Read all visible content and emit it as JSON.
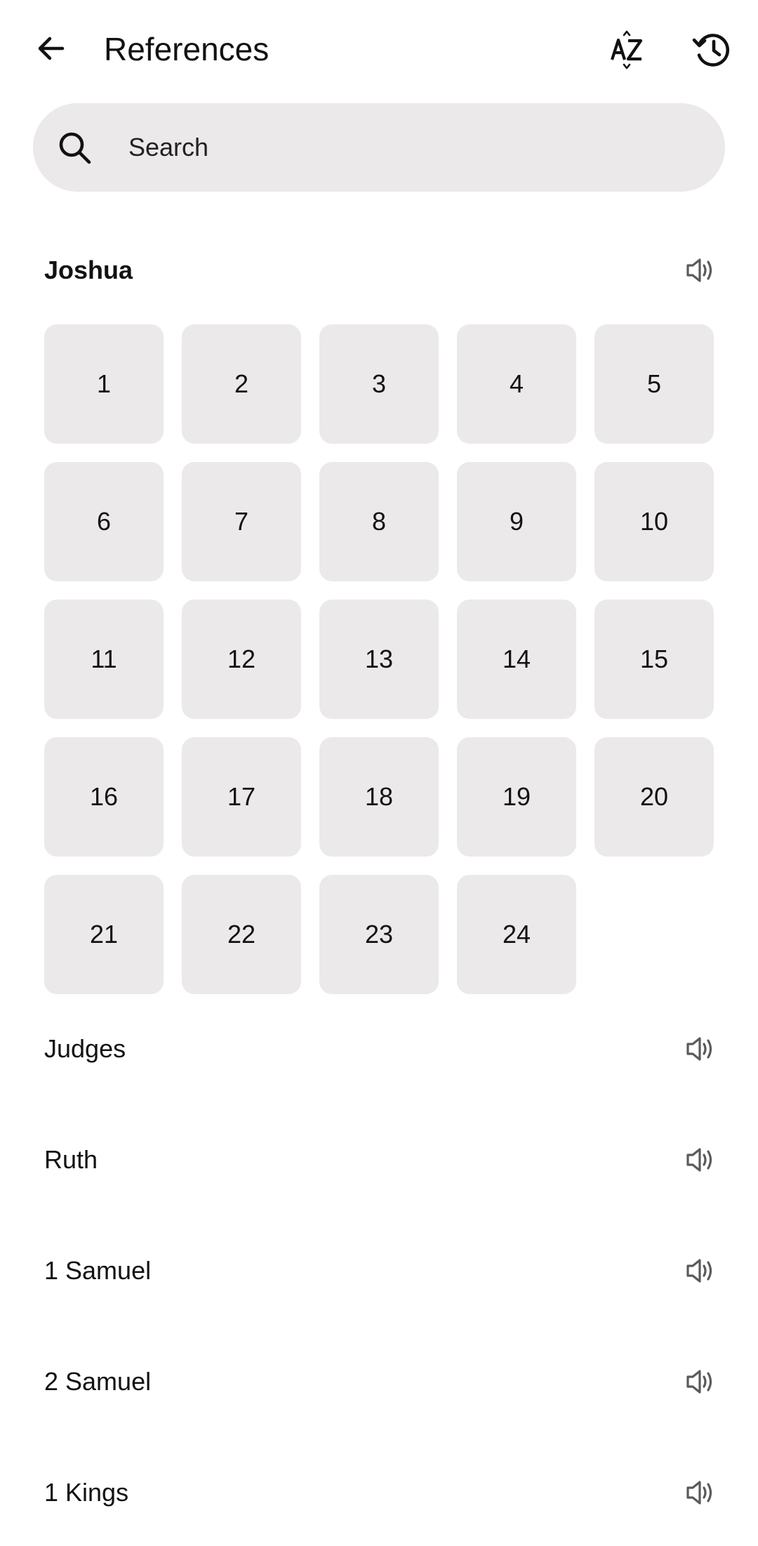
{
  "header": {
    "title": "References",
    "back_icon": "arrow-left-icon",
    "sort_icon": "az-sort-icon",
    "history_icon": "history-icon"
  },
  "search": {
    "placeholder": "Search",
    "value": ""
  },
  "expanded_book": {
    "name": "Joshua",
    "chapters": [
      "1",
      "2",
      "3",
      "4",
      "5",
      "6",
      "7",
      "8",
      "9",
      "10",
      "11",
      "12",
      "13",
      "14",
      "15",
      "16",
      "17",
      "18",
      "19",
      "20",
      "21",
      "22",
      "23",
      "24"
    ]
  },
  "books": [
    {
      "name": "Judges"
    },
    {
      "name": "Ruth"
    },
    {
      "name": "1 Samuel"
    },
    {
      "name": "2 Samuel"
    },
    {
      "name": "1 Kings"
    }
  ],
  "colors": {
    "tile_bg": "#ebe9ea",
    "text": "#121212",
    "icon_gray": "#5a5a5a"
  }
}
